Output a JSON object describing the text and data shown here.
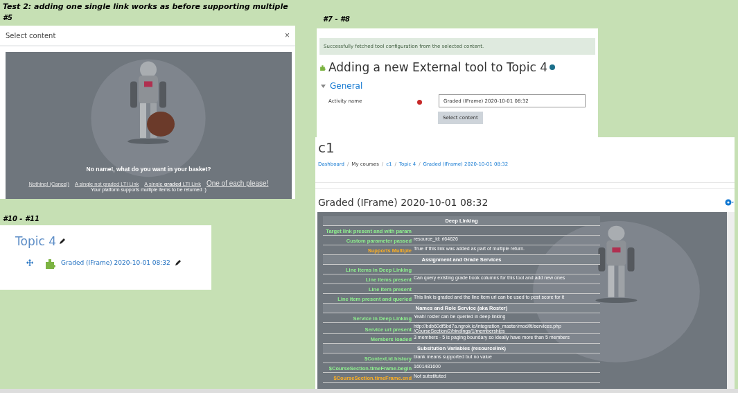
{
  "sheet": {
    "heading": "Test 2: adding one single link works as before supporting multiple",
    "captions": [
      "#5",
      "#7 - #8",
      "#10 - #11"
    ]
  },
  "select_dialog": {
    "title": "Select content",
    "close": "×",
    "question": "No name!, what do you want in your basket?",
    "links": [
      {
        "label": "Nothing! (Cancel)",
        "kind": "small"
      },
      {
        "label": "A single not graded LTI Link",
        "kind": "small"
      },
      {
        "label": "A single **graded** LTI Link",
        "kind": "small"
      },
      {
        "label": "One of each please!",
        "kind": "large"
      }
    ],
    "note": "Your platform supports multiple items to be returned :)"
  },
  "edit_form": {
    "alert": "Successfully fetched tool configuration from the selected content.",
    "heading": "Adding a new External tool to Topic 4",
    "section": {
      "label": "General",
      "expanded": true
    },
    "field": {
      "label": "Activity name",
      "required": true,
      "value": "Graded (IFrame) 2020-10-01 08:32"
    },
    "button": "Select content"
  },
  "activity_page": {
    "course": "c1",
    "breadcrumb_separator": "/",
    "breadcrumbs": [
      {
        "label": "Dashboard",
        "link": true
      },
      {
        "label": "My courses",
        "link": false
      },
      {
        "label": "c1",
        "link": true
      },
      {
        "label": "Topic 4",
        "link": true
      },
      {
        "label": "Graded (IFrame) 2020-10-01 08:32",
        "link": true
      }
    ],
    "title": "Graded (IFrame) 2020-10-01 08:32",
    "table": [
      {
        "kind": "header",
        "label": "Deep Linking"
      },
      {
        "kind": "row",
        "label": "Target link present and with param",
        "highlighted": false
      },
      {
        "kind": "row",
        "label": "Custom parameter passed",
        "highlighted": false,
        "value": "resource_id: rl64626"
      },
      {
        "kind": "row",
        "label": "Supports Multiple",
        "highlighted": true,
        "value": "True if this link was added as part of multiple return."
      },
      {
        "kind": "header",
        "label": "Assignment and Grade Services"
      },
      {
        "kind": "row",
        "label": "Line Items in Deep Linking",
        "highlighted": false
      },
      {
        "kind": "row",
        "label": "Line items present",
        "highlighted": false,
        "value": "Can query existing grade book columns for this tool and add new ones"
      },
      {
        "kind": "row",
        "label": "Line item present",
        "highlighted": false
      },
      {
        "kind": "row",
        "label": "Line item present and queried",
        "highlighted": false,
        "value": "This link is graded and the line item url can be used to post score for it"
      },
      {
        "kind": "header",
        "label": "Names and Role Service (aka Roster)"
      },
      {
        "kind": "row",
        "label": "Service in Deep Linking",
        "highlighted": false,
        "value": "Yeah! roster can be queried in deep linking"
      },
      {
        "kind": "row",
        "label": "Service url present",
        "highlighted": false,
        "value": "http://bdb60df5bd7a.ngrok.io/integration_master/mod/lti/services.php /CourseSection/2/bindings/1/memberships"
      },
      {
        "kind": "row",
        "label": "Members loaded",
        "highlighted": false,
        "value": "3 members - 5 is paging boundary so ideally have more than 5 members"
      },
      {
        "kind": "header",
        "label": "Subsitution Variables (resourcelink)"
      },
      {
        "kind": "row",
        "label": "$Context.id.history",
        "highlighted": false,
        "value": "blank means supported but no value"
      },
      {
        "kind": "row",
        "label": "$CourseSection.timeFrame.begin",
        "highlighted": false,
        "value": "1601481600"
      },
      {
        "kind": "row",
        "label": "$CourseSection.timeFrame.end",
        "highlighted": true,
        "value": "Not substituted"
      }
    ]
  },
  "course_section": {
    "title": "Topic 4",
    "activity": "Graded (IFrame) 2020-10-01 08:32"
  }
}
